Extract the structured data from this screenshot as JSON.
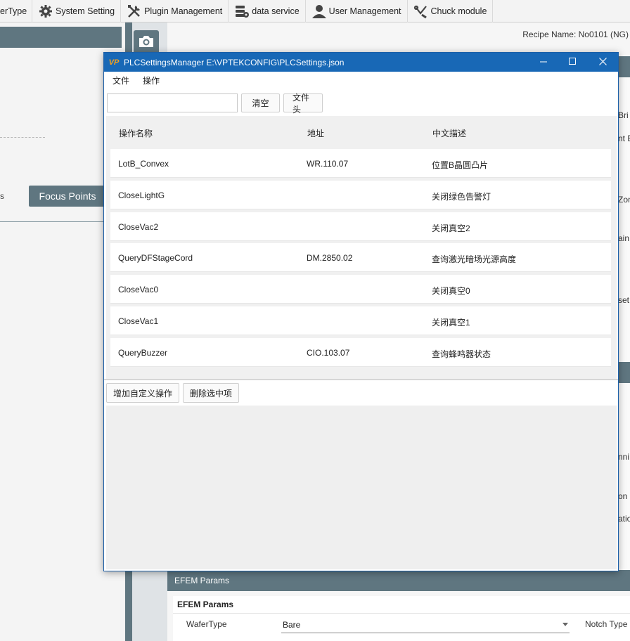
{
  "toolbar": {
    "items": [
      {
        "label": "erType",
        "icon": "wafer-type-icon"
      },
      {
        "label": "System Setting",
        "icon": "gear-icon"
      },
      {
        "label": "Plugin Management",
        "icon": "tools-icon"
      },
      {
        "label": "data service",
        "icon": "database-icon"
      },
      {
        "label": "User Management",
        "icon": "user-icon"
      },
      {
        "label": "Chuck module",
        "icon": "chuck-icon"
      }
    ]
  },
  "left_panel": {
    "small_text": "s",
    "focus_button": "Focus Points"
  },
  "right_panel": {
    "recipe": "Recipe Name: No0101 (NG)",
    "strip_texts": [
      "Bri",
      "nt B",
      "Zon",
      "ain",
      "set",
      "nni",
      "on",
      "atio"
    ]
  },
  "efem": {
    "header": "EFEM Params",
    "section_title": "EFEM Params",
    "wafer_label": "WaferType",
    "wafer_value": "Bare",
    "notch_label": "Notch Type"
  },
  "dialog": {
    "logo": "VP",
    "title": "PLCSettingsManager E:\\VPTEKCONFIG\\PLCSettings.json",
    "menu": [
      "文件",
      "操作"
    ],
    "search_value": "",
    "clear_button": "清空",
    "header_button": "文件头",
    "columns": [
      "操作名称",
      "地址",
      "中文描述"
    ],
    "rows": [
      {
        "name": "LotB_Convex",
        "address": "WR.110.07",
        "desc": "位置B晶圆凸片"
      },
      {
        "name": "CloseLightG",
        "address": "",
        "desc": "关闭绿色告警灯"
      },
      {
        "name": "CloseVac2",
        "address": "",
        "desc": "关闭真空2"
      },
      {
        "name": "QueryDFStageCord",
        "address": "DM.2850.02",
        "desc": "查询激光暗场光源高度"
      },
      {
        "name": "CloseVac0",
        "address": "",
        "desc": "关闭真空0"
      },
      {
        "name": "CloseVac1",
        "address": "",
        "desc": "关闭真空1"
      },
      {
        "name": "QueryBuzzer",
        "address": "CIO.103.07",
        "desc": "查询蜂鸣器状态"
      }
    ],
    "add_button": "增加自定义操作",
    "delete_button": "删除选中项"
  }
}
